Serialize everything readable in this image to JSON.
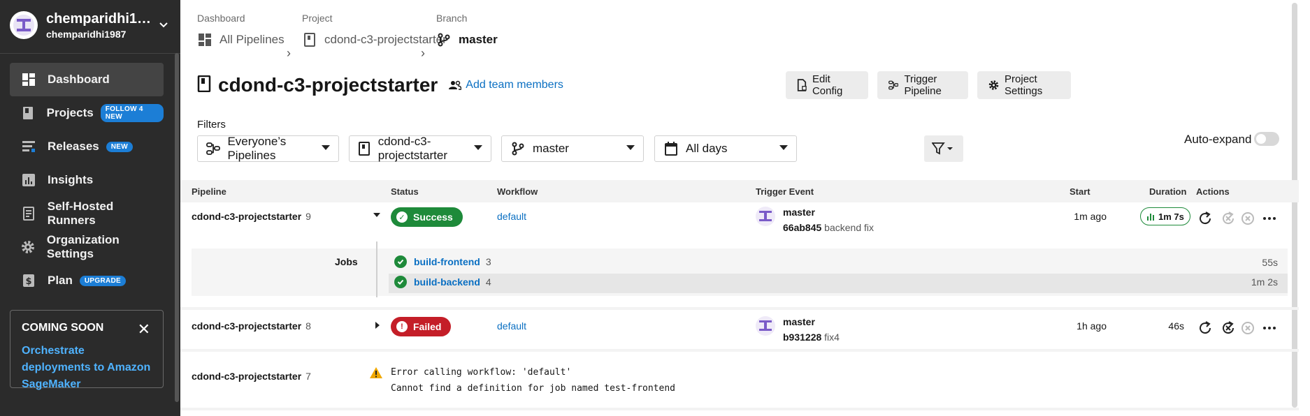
{
  "org": {
    "name": "chemparidhi1…",
    "username": "chemparidhi1987"
  },
  "nav": [
    {
      "label": "Dashboard",
      "icon": "dashboard-icon",
      "badge": ""
    },
    {
      "label": "Projects",
      "icon": "projects-icon",
      "badge": "FOLLOW 4 NEW"
    },
    {
      "label": "Releases",
      "icon": "releases-icon",
      "badge": "NEW"
    },
    {
      "label": "Insights",
      "icon": "insights-icon",
      "badge": ""
    },
    {
      "label": "Self-Hosted Runners",
      "icon": "runners-icon",
      "badge": ""
    },
    {
      "label": "Organization Settings",
      "icon": "gear-icon",
      "badge": ""
    },
    {
      "label": "Plan",
      "icon": "dollar-icon",
      "badge": "UPGRADE"
    }
  ],
  "promo": {
    "title": "COMING SOON",
    "link": "Orchestrate deployments to Amazon SageMaker"
  },
  "breadcrumb": {
    "dashboard_label": "Dashboard",
    "dashboard_value": "All Pipelines",
    "project_label": "Project",
    "project_value": "cdond-c3-projectstarter",
    "branch_label": "Branch",
    "branch_value": "master"
  },
  "header": {
    "title": "cdond-c3-projectstarter",
    "add_team": "Add team members",
    "edit_config": "Edit Config",
    "trigger_pipeline": "Trigger Pipeline",
    "project_settings": "Project Settings"
  },
  "filters": {
    "label": "Filters",
    "pipelines": "Everyone’s Pipelines",
    "project": "cdond-c3-projectstarter",
    "branch": "master",
    "days": "All days",
    "auto_expand": "Auto-expand"
  },
  "table": {
    "headers": {
      "pipeline": "Pipeline",
      "status": "Status",
      "workflow": "Workflow",
      "trigger": "Trigger Event",
      "start": "Start",
      "duration": "Duration",
      "actions": "Actions"
    },
    "rows": [
      {
        "pipeline": "cdond-c3-projectstarter",
        "number": "9",
        "status": "Success",
        "workflow": "default",
        "branch": "master",
        "sha": "66ab845",
        "message": "backend fix",
        "start": "1m ago",
        "duration": "1m 7s"
      },
      {
        "pipeline": "cdond-c3-projectstarter",
        "number": "8",
        "status": "Failed",
        "workflow": "default",
        "branch": "master",
        "sha": "b931228",
        "message": "fix4",
        "start": "1h ago",
        "duration": "46s"
      },
      {
        "pipeline": "cdond-c3-projectstarter",
        "number": "7",
        "error_line1": "Error calling workflow: 'default'",
        "error_line2": "Cannot find a definition for job named test-frontend"
      }
    ],
    "jobs_label": "Jobs",
    "jobs": [
      {
        "name": "build-frontend",
        "number": "3",
        "duration": "55s"
      },
      {
        "name": "build-backend",
        "number": "4",
        "duration": "1m 2s"
      }
    ]
  },
  "colors": {
    "success": "#1e8a3a",
    "failed": "#c41e28",
    "link": "#0a6fc2",
    "sidebar": "#2b2b2b",
    "badge": "#1c7ed6"
  }
}
